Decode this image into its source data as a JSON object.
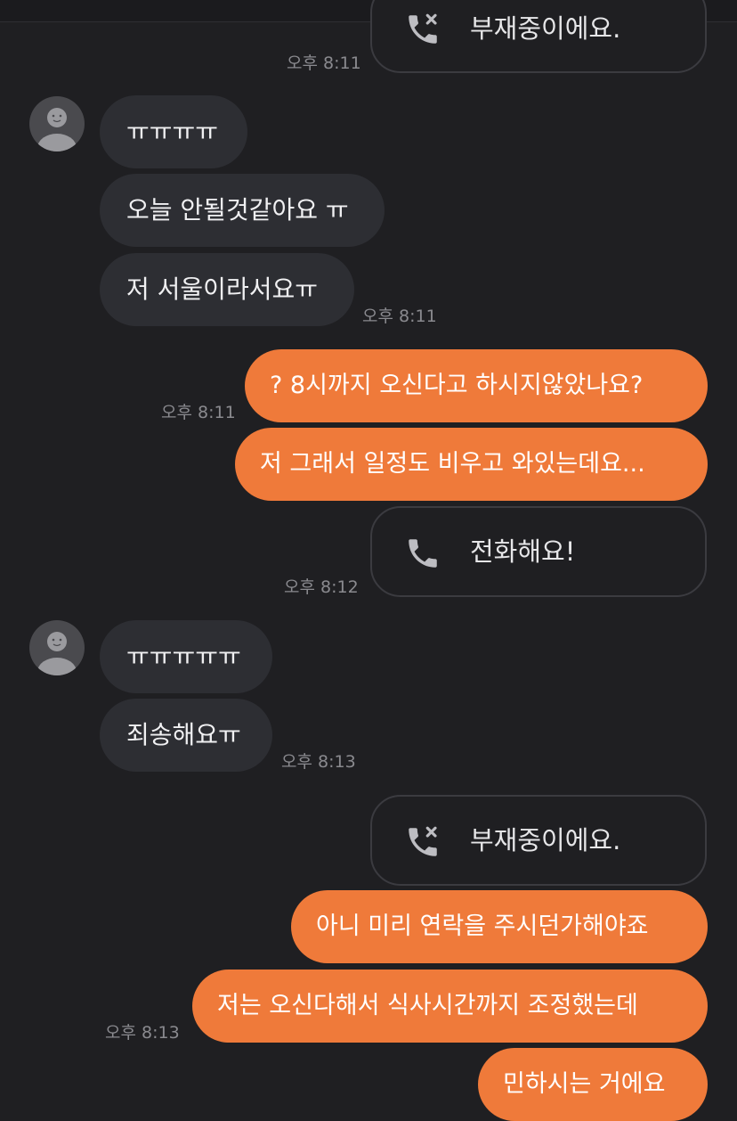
{
  "colors": {
    "background": "#1f1f22",
    "incoming_bubble": "#2d2e33",
    "outgoing_bubble": "#ef7a3a",
    "timestamp": "#8a8a8f"
  },
  "messages": {
    "top_call": {
      "label": "부재중이에요.",
      "time": "오후 8:11",
      "icon": "missed-call-icon"
    },
    "group1": {
      "b1": "ㅠㅠㅠㅠ",
      "b2": "오늘 안될것같아요 ㅠ",
      "b3": "저 서울이라서요ㅠ",
      "time": "오후 8:11"
    },
    "out1": {
      "b1": "? 8시까지 오신다고 하시지않았나요?",
      "time": "오후 8:11",
      "b2": "저 그래서 일정도 비우고 와있는데요..."
    },
    "call2": {
      "label": "전화해요!",
      "time": "오후 8:12",
      "icon": "phone-icon"
    },
    "group2": {
      "b1": "ㅠㅠㅠㅠㅠ",
      "b2": "죄송해요ㅠ",
      "time": "오후 8:13"
    },
    "call3": {
      "label": "부재중이에요.",
      "icon": "missed-call-icon"
    },
    "out2": {
      "b1": "아니 미리 연락을 주시던가해야죠",
      "b2": "저는 오신다해서 식사시간까지 조정했는데",
      "time": "오후 8:13",
      "b3": "민하시는 거에요"
    }
  }
}
